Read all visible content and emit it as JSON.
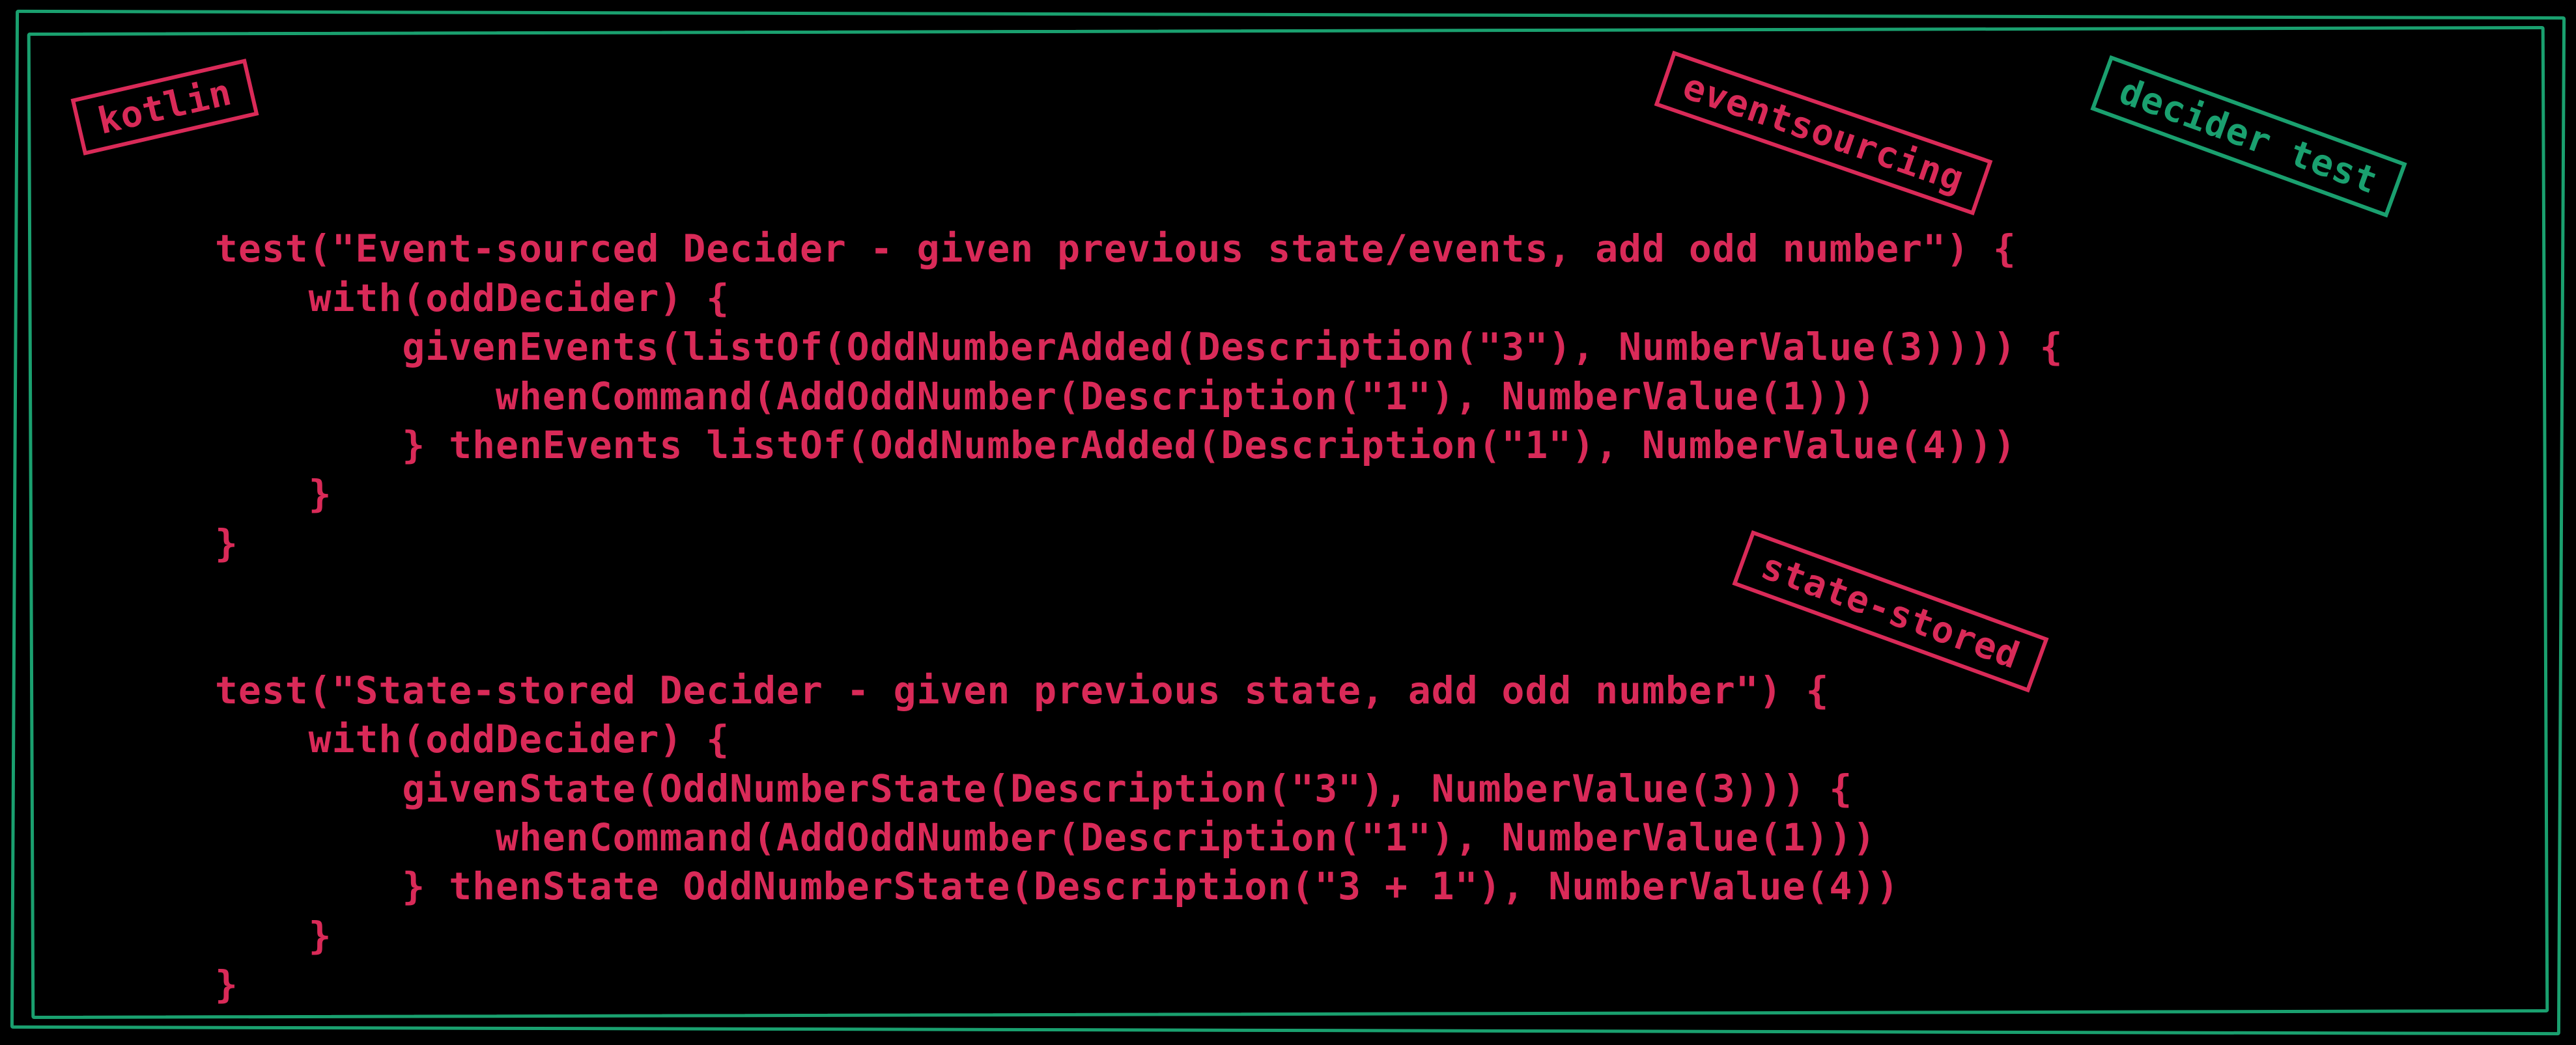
{
  "tags": {
    "kotlin": "kotlin",
    "eventsourcing": "eventsourcing",
    "decider_test": "decider test",
    "state_stored": "state-stored"
  },
  "code": {
    "block1": {
      "l1": "test(\"Event-sourced Decider - given previous state/events, add odd number\") {",
      "l2": "    with(oddDecider) {",
      "l3": "        givenEvents(listOf(OddNumberAdded(Description(\"3\"), NumberValue(3)))) {",
      "l4": "            whenCommand(AddOddNumber(Description(\"1\"), NumberValue(1)))",
      "l5": "        } thenEvents listOf(OddNumberAdded(Description(\"1\"), NumberValue(4)))",
      "l6": "    }",
      "l7": "}"
    },
    "block2": {
      "l1": "test(\"State-stored Decider - given previous state, add odd number\") {",
      "l2": "    with(oddDecider) {",
      "l3": "        givenState(OddNumberState(Description(\"3\"), NumberValue(3))) {",
      "l4": "            whenCommand(AddOddNumber(Description(\"1\"), NumberValue(1)))",
      "l5": "        } thenState OddNumberState(Description(\"3 + 1\"), NumberValue(4))",
      "l6": "    }",
      "l7": "}"
    }
  }
}
